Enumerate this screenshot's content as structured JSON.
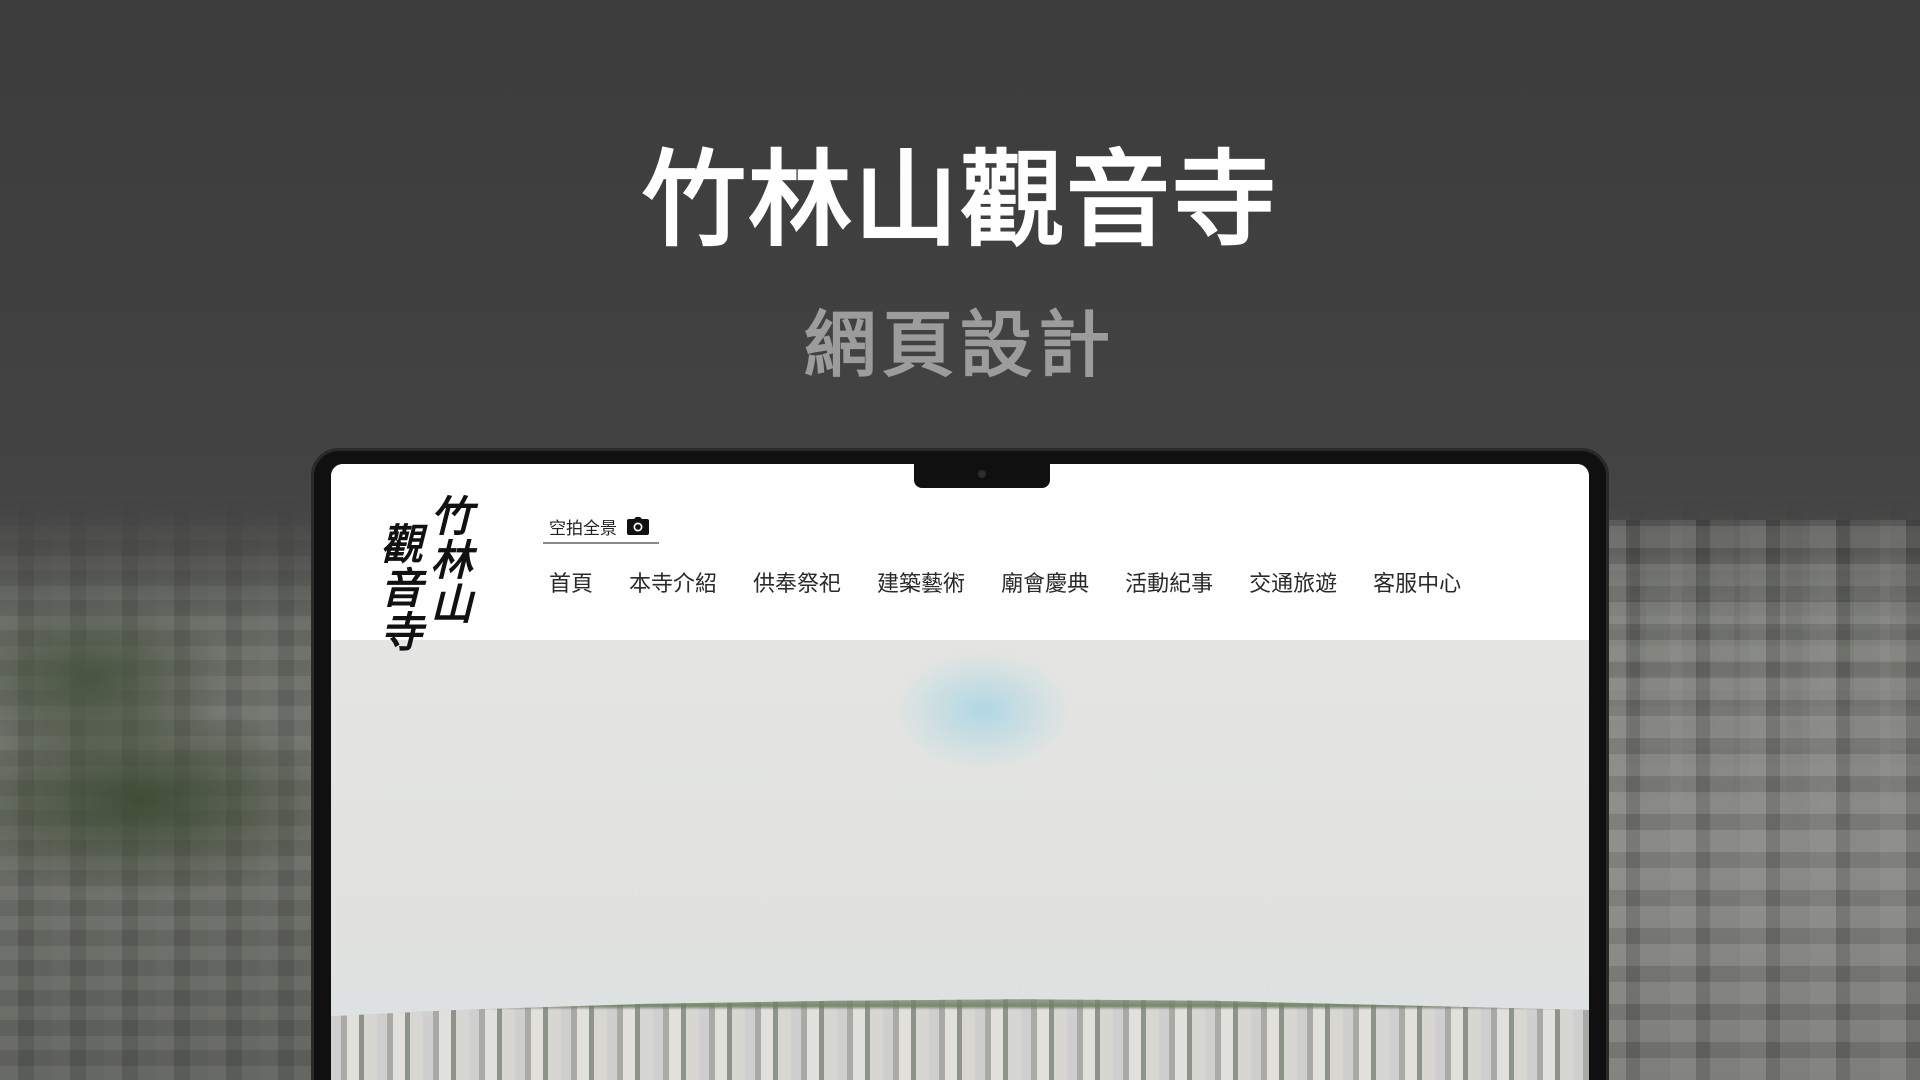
{
  "hero": {
    "title": "竹林山觀音寺",
    "subtitle": "網頁設計"
  },
  "site": {
    "logo_text_col1": "竹林山",
    "logo_text_col2": "觀音寺",
    "aerial_link_label": "空拍全景",
    "aerial_link_icon": "camera-icon",
    "nav": [
      {
        "label": "首頁"
      },
      {
        "label": "本寺介紹"
      },
      {
        "label": "供奉祭祀"
      },
      {
        "label": "建築藝術"
      },
      {
        "label": "廟會慶典"
      },
      {
        "label": "活動紀事"
      },
      {
        "label": "交通旅遊"
      },
      {
        "label": "客服中心"
      }
    ]
  },
  "colors": {
    "background": "#434343",
    "title": "#ffffff",
    "subtitle": "#9c9c9c",
    "laptop_bezel": "#101010",
    "header_bg": "#ffffff",
    "nav_text": "#2a2a2a"
  }
}
